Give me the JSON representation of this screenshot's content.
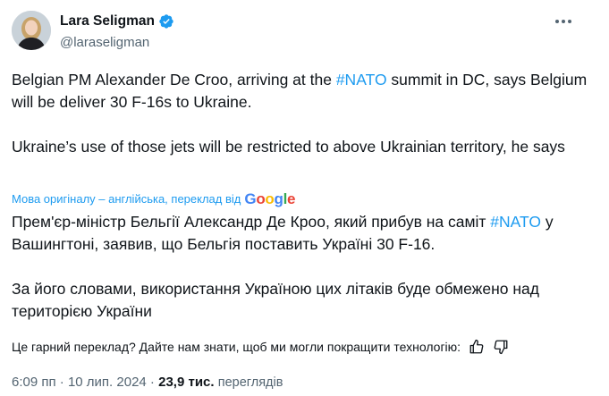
{
  "author": {
    "display_name": "Lara Seligman",
    "handle": "@laraseligman",
    "verified": true
  },
  "tweet": {
    "line1_part1": "Belgian PM Alexander De Croo, arriving at the ",
    "line1_hashtag": "#NATO",
    "line1_part2": " summit in DC, says Belgium will be deliver 30 F-16s to Ukraine.",
    "paragraph2": "Ukraine’s use of those jets will be restricted to above Ukrainian territory, he says"
  },
  "translation": {
    "attribution": "Мова оригіналу – англійська, переклад від",
    "google": [
      "G",
      "o",
      "o",
      "g",
      "l",
      "e"
    ],
    "text_part1": "Прем'єр-міністр Бельгії Александр Де Кроо, який прибув на саміт ",
    "hashtag": "#NATO",
    "text_part2": " у Вашингтоні, заявив, що Бельгія поставить Україні 30 F-16.",
    "paragraph2": "За його словами, використання Україною цих літаків буде обмежено над територією України"
  },
  "feedback": {
    "question": "Це гарний переклад? Дайте нам знати, щоб ми могли покращити технологію:",
    "thumbs_up_icon": "thumbs-up-icon",
    "thumbs_down_icon": "thumbs-down-icon"
  },
  "meta": {
    "time": "6:09 пп",
    "separator": " · ",
    "date": "10 лип. 2024",
    "views_count": "23,9 тис.",
    "views_label": "переглядів"
  },
  "colors": {
    "accent": "#1d9bf0",
    "text": "#0f1419",
    "muted": "#536471"
  }
}
